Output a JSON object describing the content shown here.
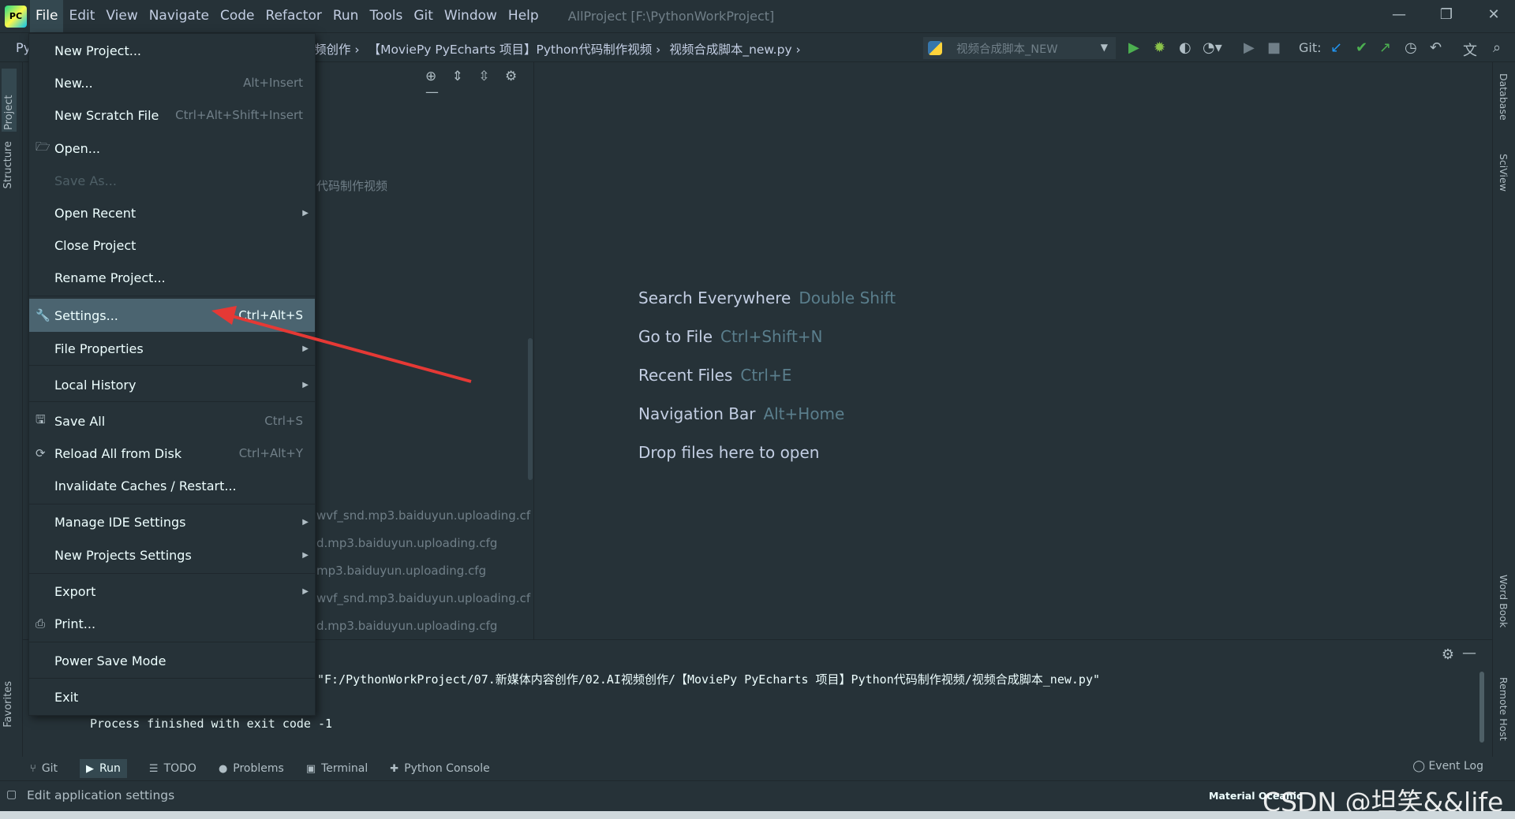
{
  "menubar": {
    "logo": "PC",
    "items": [
      "File",
      "Edit",
      "View",
      "Navigate",
      "Code",
      "Refactor",
      "Run",
      "Tools",
      "Git",
      "Window",
      "Help"
    ],
    "window_title": "AllProject [F:\\PythonWorkProject]",
    "minimize": "—",
    "restore": "❐",
    "close": "✕"
  },
  "navbar": {
    "project_prefix": "Py",
    "breadcrumbs": [
      "频创作 ›",
      "【MoviePy PyEcharts 项目】Python代码制作视频 ›",
      "视频合成脚本_new.py ›"
    ],
    "run_config": "视频合成脚本_NEW",
    "git_label": "Git:"
  },
  "left_stripe": {
    "project": "Project",
    "structure": "Structure",
    "favorites": "Favorites"
  },
  "right_stripe": {
    "database": "Database",
    "sciview": "SciView",
    "word_book": "Word Book",
    "remote_host": "Remote Host"
  },
  "project_panel": {
    "folder_fragment": "代码制作视频",
    "files": [
      "wvf_snd.mp3.baiduyun.uploading.cf",
      "d.mp3.baiduyun.uploading.cfg",
      "mp3.baiduyun.uploading.cfg",
      "wvf_snd.mp3.baiduyun.uploading.cf",
      "d.mp3.baiduyun.uploading.cfg"
    ]
  },
  "editor": {
    "hints": [
      {
        "label": "Search Everywhere",
        "key": "Double Shift"
      },
      {
        "label": "Go to File",
        "key": "Ctrl+Shift+N"
      },
      {
        "label": "Recent Files",
        "key": "Ctrl+E"
      },
      {
        "label": "Navigation Bar",
        "key": "Alt+Home"
      },
      {
        "label": "Drop files here to open",
        "key": ""
      }
    ]
  },
  "run_panel": {
    "command": "\"F:/PythonWorkProject/07.新媒体内容创作/02.AI视频创作/【MoviePy PyEcharts 项目】Python代码制作视频/视频合成脚本_new.py\"",
    "exit_text": "Process finished with exit code -1"
  },
  "bottom_tabs": [
    {
      "icon": "⑂",
      "label": "Git"
    },
    {
      "icon": "▶",
      "label": "Run"
    },
    {
      "icon": "☰",
      "label": "TODO"
    },
    {
      "icon": "●",
      "label": "Problems"
    },
    {
      "icon": "▣",
      "label": "Terminal"
    },
    {
      "icon": "✚",
      "label": "Python Console"
    }
  ],
  "event_log": "Event Log",
  "statusbar": {
    "text": "Edit application settings",
    "theme": "Material Oceanic",
    "watermark": "CSDN @坦笑&&life"
  },
  "file_menu": {
    "items": [
      {
        "label": "New Project...",
        "shortcut": ""
      },
      {
        "label": "New...",
        "shortcut": "Alt+Insert"
      },
      {
        "label": "New Scratch File",
        "shortcut": "Ctrl+Alt+Shift+Insert"
      },
      {
        "label": "Open...",
        "shortcut": ""
      },
      {
        "label": "Save As...",
        "shortcut": ""
      },
      {
        "label": "Open Recent",
        "shortcut": ""
      },
      {
        "label": "Close Project",
        "shortcut": ""
      },
      {
        "label": "Rename Project...",
        "shortcut": ""
      },
      {
        "label": "Settings...",
        "shortcut": "Ctrl+Alt+S"
      },
      {
        "label": "File Properties",
        "shortcut": ""
      },
      {
        "label": "Local History",
        "shortcut": ""
      },
      {
        "label": "Save All",
        "shortcut": "Ctrl+S"
      },
      {
        "label": "Reload All from Disk",
        "shortcut": "Ctrl+Alt+Y"
      },
      {
        "label": "Invalidate Caches / Restart...",
        "shortcut": ""
      },
      {
        "label": "Manage IDE Settings",
        "shortcut": ""
      },
      {
        "label": "New Projects Settings",
        "shortcut": ""
      },
      {
        "label": "Export",
        "shortcut": ""
      },
      {
        "label": "Print...",
        "shortcut": ""
      },
      {
        "label": "Power Save Mode",
        "shortcut": ""
      },
      {
        "label": "Exit",
        "shortcut": ""
      }
    ]
  },
  "colors": {
    "background": "#263238",
    "selection": "#4b6470",
    "annotation_arrow": "#e53935"
  }
}
